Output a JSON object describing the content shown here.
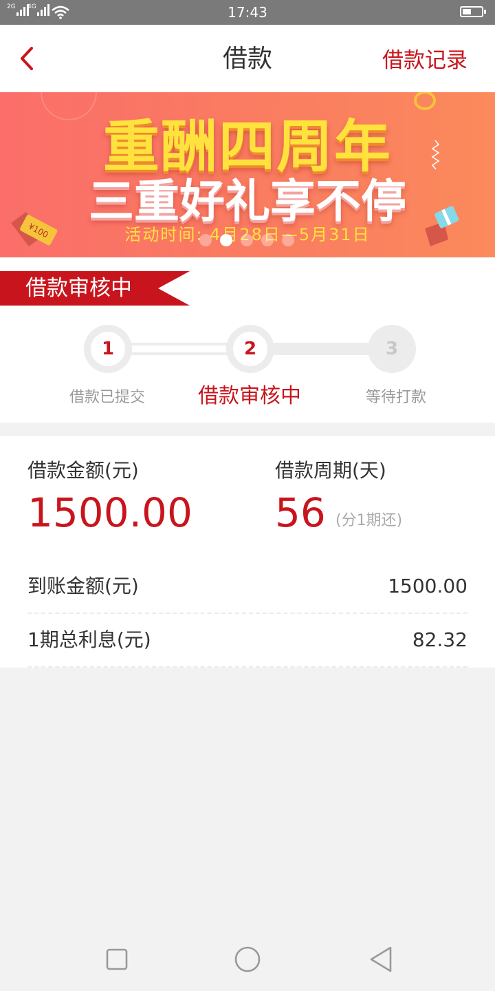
{
  "status_bar": {
    "network_1": "2G",
    "network_2": "4G",
    "time": "17:43",
    "battery_level": 0.45
  },
  "header": {
    "title": "借款",
    "records_link": "借款记录",
    "back_icon": "chevron-left-icon"
  },
  "banner": {
    "headline_1": "重酬四周年",
    "headline_2": "三重好礼享不停",
    "period": "活动时间: 4月28日—5月31日",
    "ticket_text": "¥100",
    "slide_count": 5,
    "active_slide": 2
  },
  "review": {
    "badge": "借款审核中",
    "steps": [
      {
        "number": "1",
        "label": "借款已提交"
      },
      {
        "number": "2",
        "label": "借款审核中"
      },
      {
        "number": "3",
        "label": "等待打款"
      }
    ],
    "current_step": 2
  },
  "loan": {
    "amount_label": "借款金额(元)",
    "amount": "1500.00",
    "term_label": "借款周期(天)",
    "term": "56",
    "term_note": "(分1期还)",
    "rows": [
      {
        "label": "到账金额(元)",
        "value": "1500.00"
      },
      {
        "label": "1期总利息(元)",
        "value": "82.32"
      }
    ]
  },
  "colors": {
    "accent": "#c8151d",
    "banner_yellow": "#ffe23d",
    "background": "#f2f2f2"
  },
  "nav": {
    "icons": [
      "square-recents-icon",
      "circle-home-icon",
      "triangle-back-icon"
    ]
  }
}
